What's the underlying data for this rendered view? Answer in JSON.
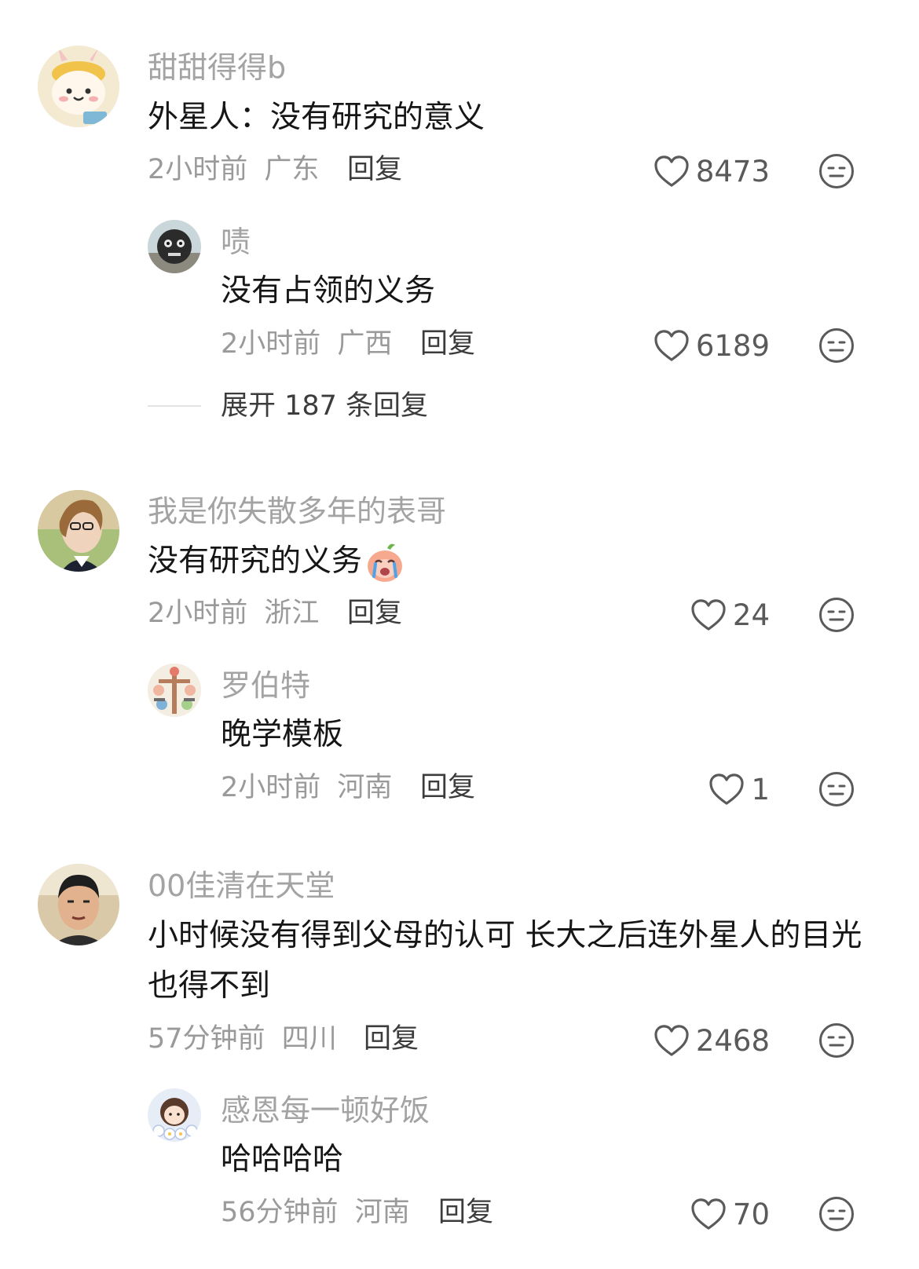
{
  "comments": [
    {
      "username": "甜甜得得b",
      "text": "外星人：没有研究的意义",
      "time": "2小时前",
      "location": "广东",
      "reply_label": "回复",
      "likes": "8473",
      "replies": [
        {
          "username": "啧",
          "text": "没有占领的义务",
          "time": "2小时前",
          "location": "广西",
          "reply_label": "回复",
          "likes": "6189"
        }
      ],
      "expand_label": "展开 187 条回复"
    },
    {
      "username": "我是你失散多年的表哥",
      "text": "没有研究的义务",
      "time": "2小时前",
      "location": "浙江",
      "reply_label": "回复",
      "likes": "24",
      "replies": [
        {
          "username": "罗伯特",
          "text": "晚学模板",
          "time": "2小时前",
          "location": "河南",
          "reply_label": "回复",
          "likes": "1"
        }
      ]
    },
    {
      "username": "00佳清在天堂",
      "text": "小时候没有得到父母的认可 长大之后连外星人的目光也得不到",
      "time": "57分钟前",
      "location": "四川",
      "reply_label": "回复",
      "likes": "2468",
      "replies": [
        {
          "username": "感恩每一顿好饭",
          "text": "哈哈哈哈",
          "time": "56分钟前",
          "location": "河南",
          "reply_label": "回复",
          "likes": "70"
        }
      ]
    }
  ],
  "icons": {
    "like": "heart-outline-icon",
    "dislike": "meh-face-icon",
    "emoji": "crying-emoji-icon"
  },
  "colors": {
    "username": "#a3a3a3",
    "text": "#161616",
    "meta": "#9a9a9a",
    "reply": "#3c3c3c",
    "icon": "#5a5a5a"
  }
}
